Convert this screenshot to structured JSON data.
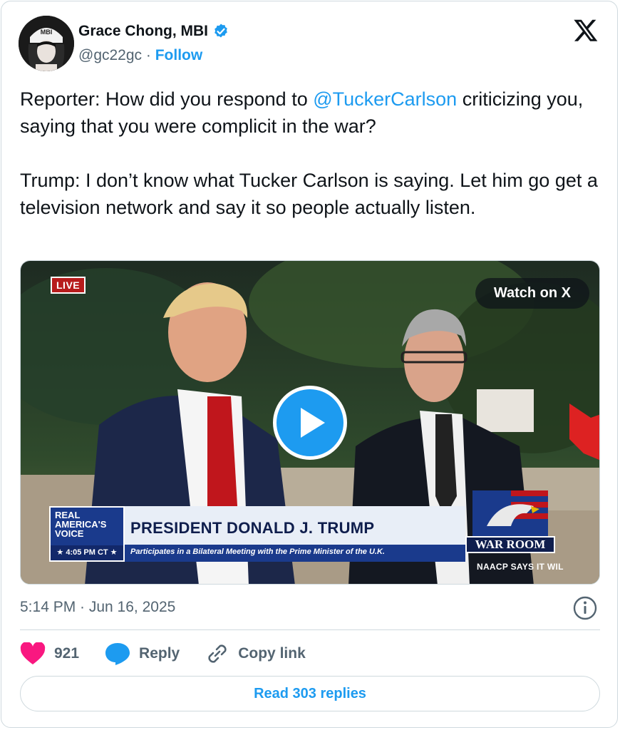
{
  "author": {
    "name": "Grace Chong, MBI",
    "handle": "@gc22gc",
    "separator": "·",
    "follow_label": "Follow",
    "avatar_cap_text": "MBI",
    "verified_color": "#1d9bf0"
  },
  "tweet": {
    "paragraph1_before": "Reporter: How did you respond to ",
    "mention": "@TuckerCarlson",
    "paragraph1_after": " criticizing you, saying that you were complicit in the war?",
    "paragraph2": "Trump: I don’t know what Tucker Carlson is saying. Let him go get a television network and say it so people actually listen."
  },
  "video": {
    "live_badge": "LIVE",
    "watch_label": "Watch on X",
    "network_line1": "REAL",
    "network_line2": "AMERICA'S",
    "network_line3": "VOICE",
    "time_label": "★ 4:05 PM CT ★",
    "headline": "PRESIDENT DONALD J. TRUMP",
    "subheadline": "Participates in a Bilateral Meeting with the Prime Minister of the U.K.",
    "show_logo": "WAR ROOM",
    "ticker": "NAACP SAYS IT WIL"
  },
  "footer": {
    "timestamp": "5:14 PM · Jun 16, 2025",
    "like_count": "921",
    "reply_label": "Reply",
    "copy_link_label": "Copy link",
    "read_replies_label": "Read 303 replies"
  },
  "colors": {
    "accent": "#1d9bf0",
    "like": "#f91880",
    "text_secondary": "#536471"
  },
  "icons": [
    "x-logo-icon",
    "verified-badge-icon",
    "play-icon",
    "info-icon",
    "heart-icon",
    "reply-bubble-icon",
    "link-icon"
  ]
}
